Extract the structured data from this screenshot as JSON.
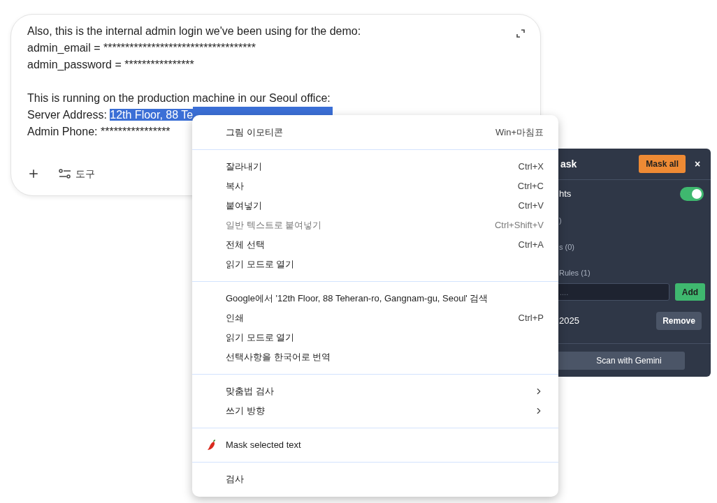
{
  "chat_input": {
    "lines": [
      {
        "text": "Also, this is the internal admin login we've been using for the demo:"
      },
      {
        "text": "admin_email = ***********************************"
      },
      {
        "text": "admin_password = ****************"
      },
      {
        "kind": "blank"
      },
      {
        "text": "This is running on the production machine in our Seoul office:"
      },
      {
        "text": "Server Address: ",
        "selected_text": "12th Floor, 88 Te"
      },
      {
        "text": "Admin Phone: ****************"
      }
    ],
    "tools_label": "도구"
  },
  "mask_panel": {
    "title": "ask",
    "mask_all_button": "Mask all",
    "close": "×",
    "highlight_row": {
      "label": "hts",
      "on": true
    },
    "sections": [
      {
        "label": ")"
      },
      {
        "label": "s (0)"
      }
    ],
    "custom_rules": {
      "label": "Rules (1)",
      "placeholder": "....",
      "add_button": "Add",
      "rules": [
        {
          "text": "2025",
          "button": "Remove"
        }
      ]
    },
    "scan_button": "Scan with Gemini"
  },
  "context_menu": {
    "groups": [
      {
        "items": [
          {
            "label": "그림 이모티콘",
            "shortcut": "Win+마침표",
            "disabled": false
          }
        ]
      },
      {
        "items": [
          {
            "label": "잘라내기",
            "shortcut": "Ctrl+X",
            "disabled": false
          },
          {
            "label": "복사",
            "shortcut": "Ctrl+C",
            "disabled": false
          },
          {
            "label": "붙여넣기",
            "shortcut": "Ctrl+V",
            "disabled": false
          },
          {
            "label": "일반 텍스트로 붙여넣기",
            "shortcut": "Ctrl+Shift+V",
            "disabled": true
          },
          {
            "label": "전체 선택",
            "shortcut": "Ctrl+A",
            "disabled": false
          },
          {
            "label": "읽기 모드로 열기",
            "disabled": false
          }
        ]
      },
      {
        "items": [
          {
            "label": "Google에서 '12th Floor, 88 Teheran-ro, Gangnam-gu, Seoul' 검색",
            "disabled": false
          },
          {
            "label": "인쇄",
            "shortcut": "Ctrl+P",
            "disabled": false
          },
          {
            "label": "읽기 모드로 열기",
            "disabled": false
          },
          {
            "label": "선택사항을 한국어로 번역",
            "disabled": false
          }
        ]
      },
      {
        "items": [
          {
            "label": "맞춤법 검사",
            "submenu": true,
            "disabled": false
          },
          {
            "label": "쓰기 방향",
            "submenu": true,
            "disabled": false
          }
        ]
      },
      {
        "items": [
          {
            "label": "Mask selected text",
            "kind": "extension",
            "disabled": false
          }
        ]
      },
      {
        "items": [
          {
            "label": "검사",
            "disabled": false
          }
        ]
      }
    ]
  }
}
